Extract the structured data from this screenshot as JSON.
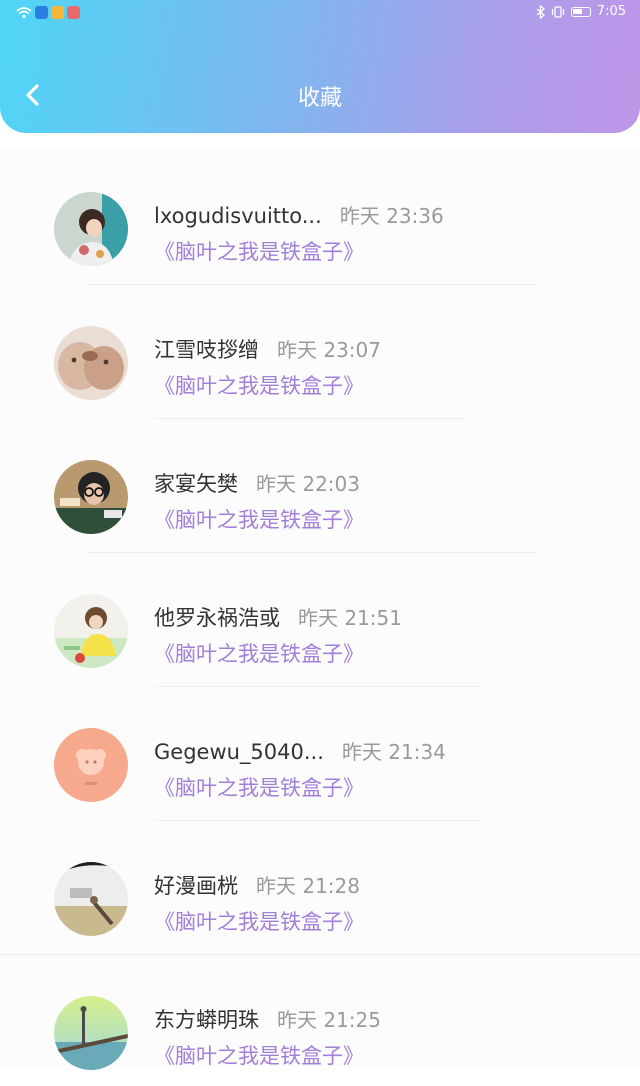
{
  "status_bar": {
    "time": "7:05"
  },
  "header": {
    "title": "收藏",
    "back_icon": "chevron-left-icon"
  },
  "favorites": [
    {
      "name": "lxogudisvuitto...",
      "time": "昨天 23:36",
      "book": "《脑叶之我是铁盒子》"
    },
    {
      "name": "江雪吱拶缯",
      "time": "昨天 23:07",
      "book": "《脑叶之我是铁盒子》"
    },
    {
      "name": "家宴矢樊",
      "time": "昨天 22:03",
      "book": "《脑叶之我是铁盒子》"
    },
    {
      "name": "他罗永祸浩或",
      "time": "昨天 21:51",
      "book": "《脑叶之我是铁盒子》"
    },
    {
      "name": "Gegewu_5040...",
      "time": "昨天 21:34",
      "book": "《脑叶之我是铁盒子》"
    },
    {
      "name": "好漫画桄",
      "time": "昨天 21:28",
      "book": "《脑叶之我是铁盒子》"
    },
    {
      "name": "东方蟒明珠",
      "time": "昨天 21:25",
      "book": "《脑叶之我是铁盒子》"
    }
  ],
  "colors": {
    "header_gradient_start": "#4fd6f7",
    "header_gradient_end": "#bf95e8",
    "book_title": "#a27fd8",
    "time_text": "#9a9a9a",
    "name_text": "#333333"
  }
}
